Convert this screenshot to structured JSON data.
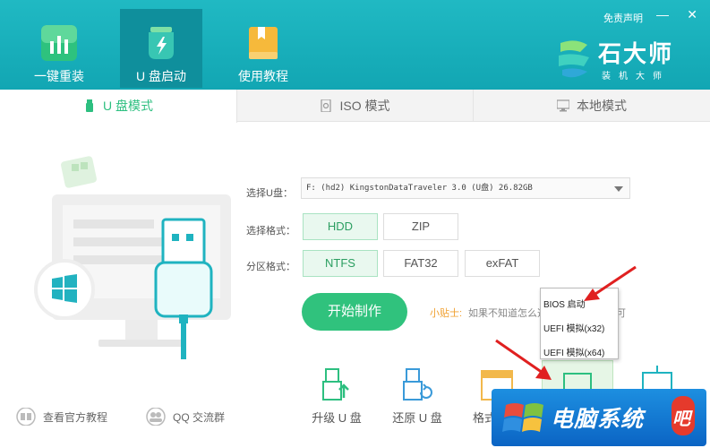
{
  "header": {
    "disclaimer": "免责声明",
    "minimize": "—",
    "close": "✕",
    "brand_name": "石大师",
    "brand_sub": "装机大师",
    "nav": [
      {
        "label": "一键重装",
        "icon": "bar-chart-icon"
      },
      {
        "label": "U 盘启动",
        "icon": "usb-drive-icon"
      },
      {
        "label": "使用教程",
        "icon": "book-icon"
      }
    ]
  },
  "tabs": [
    {
      "label": "U 盘模式",
      "icon": "usb-stick-icon"
    },
    {
      "label": "ISO 模式",
      "icon": "iso-file-icon"
    },
    {
      "label": "本地模式",
      "icon": "monitor-icon"
    }
  ],
  "form": {
    "usb_label": "选择U盘：",
    "usb_value": "F: (hd2) KingstonDataTraveler 3.0 (U盘) 26.82GB",
    "format_label": "选择格式：",
    "formats": [
      "HDD",
      "ZIP"
    ],
    "partition_label": "分区格式：",
    "partitions": [
      "NTFS",
      "FAT32",
      "exFAT"
    ],
    "start_button": "开始制作",
    "tip_title": "小贴士:",
    "tip_text": "如果不知道怎么选择，保持默认即可"
  },
  "dropdown": {
    "items": [
      "BIOS 启动",
      "UEFI 模拟(x32)",
      "UEFI 模拟(x64)"
    ]
  },
  "tools": [
    {
      "label": "升级 U 盘",
      "icon": "upgrade-usb-icon"
    },
    {
      "label": "还原 U 盘",
      "icon": "restore-usb-icon"
    },
    {
      "label": "格式",
      "icon": "format-icon"
    }
  ],
  "bottom_links": {
    "tutorial": "查看官方教程",
    "qq": "QQ 交流群"
  },
  "watermark": {
    "text": "电脑系统",
    "badge": "吧"
  },
  "colors": {
    "header": "#16acb9",
    "accent_green": "#30c27d",
    "arrow_red": "#e02020"
  }
}
